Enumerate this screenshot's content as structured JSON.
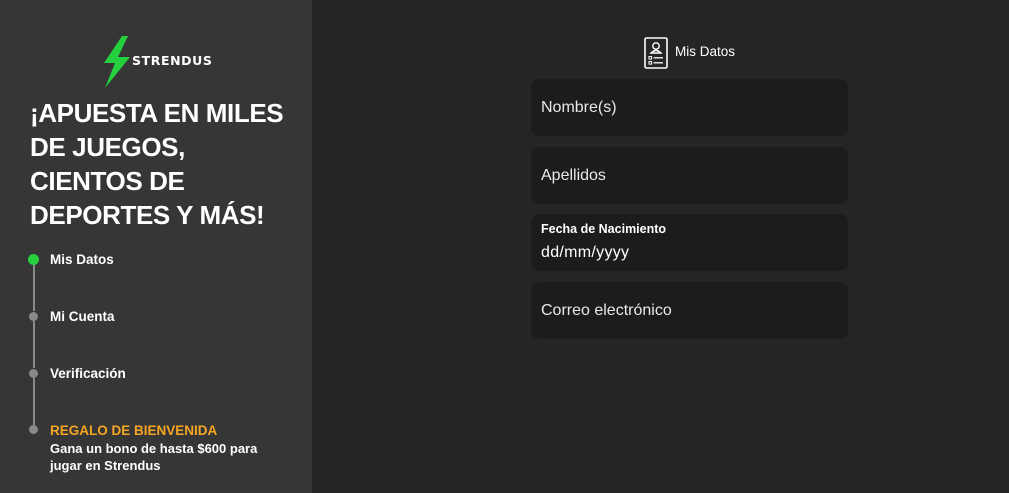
{
  "brand": {
    "name": "STRENDUS",
    "accent_color": "#25d03f",
    "logo_icon": "lightning-bolt-icon"
  },
  "sidebar": {
    "headline": "¡APUESTA EN MILES DE JUEGOS, CIENTOS DE DEPORTES Y MÁS!",
    "steps": [
      {
        "label": "Mis Datos",
        "active": true
      },
      {
        "label": "Mi Cuenta",
        "active": false
      },
      {
        "label": "Verificación",
        "active": false
      }
    ],
    "gift": {
      "title": "REGALO DE BIENVENIDA",
      "description": "Gana un bono de hasta $600 para jugar en Strendus",
      "color": "#f5a623"
    }
  },
  "form": {
    "header_label": "Mis Datos",
    "header_icon": "document-profile-icon",
    "fields": {
      "nombre_placeholder": "Nombre(s)",
      "apellidos_placeholder": "Apellidos",
      "fecha_label": "Fecha de Nacimiento",
      "fecha_value": "dd/mm/yyyy",
      "correo_placeholder": "Correo electrónico"
    }
  }
}
